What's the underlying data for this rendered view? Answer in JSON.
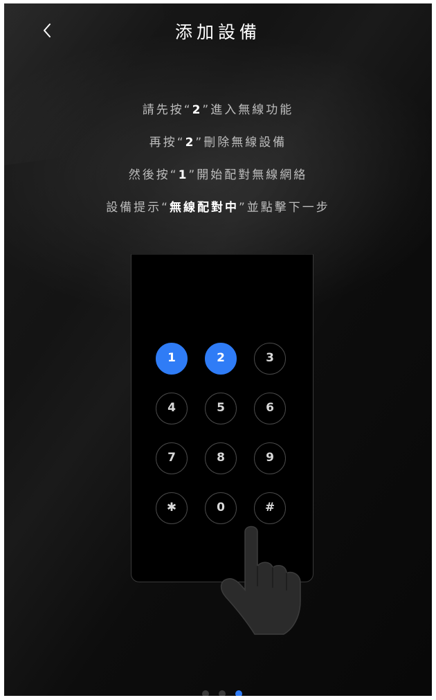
{
  "header": {
    "title": "添加設備"
  },
  "instructions": [
    {
      "pre": "請先按“",
      "bold": "2",
      "post": "”進入無線功能"
    },
    {
      "pre": "再按“",
      "bold": "2",
      "post": "”刪除無線設備"
    },
    {
      "pre": "然後按“",
      "bold": "1",
      "post": "”開始配對無線網絡"
    },
    {
      "pre": "設備提示“",
      "bold": "無線配對中",
      "post": "”並點擊下一步"
    }
  ],
  "keypad": {
    "keys": [
      "1",
      "2",
      "3",
      "4",
      "5",
      "6",
      "7",
      "8",
      "9",
      "✱",
      "0",
      "#"
    ],
    "highlighted": [
      "1",
      "2"
    ]
  },
  "pager": {
    "count": 3,
    "active_index": 2
  },
  "colors": {
    "accent": "#2f7cf6",
    "background": "#0d0d0d",
    "text_secondary": "#bdbdbd"
  }
}
